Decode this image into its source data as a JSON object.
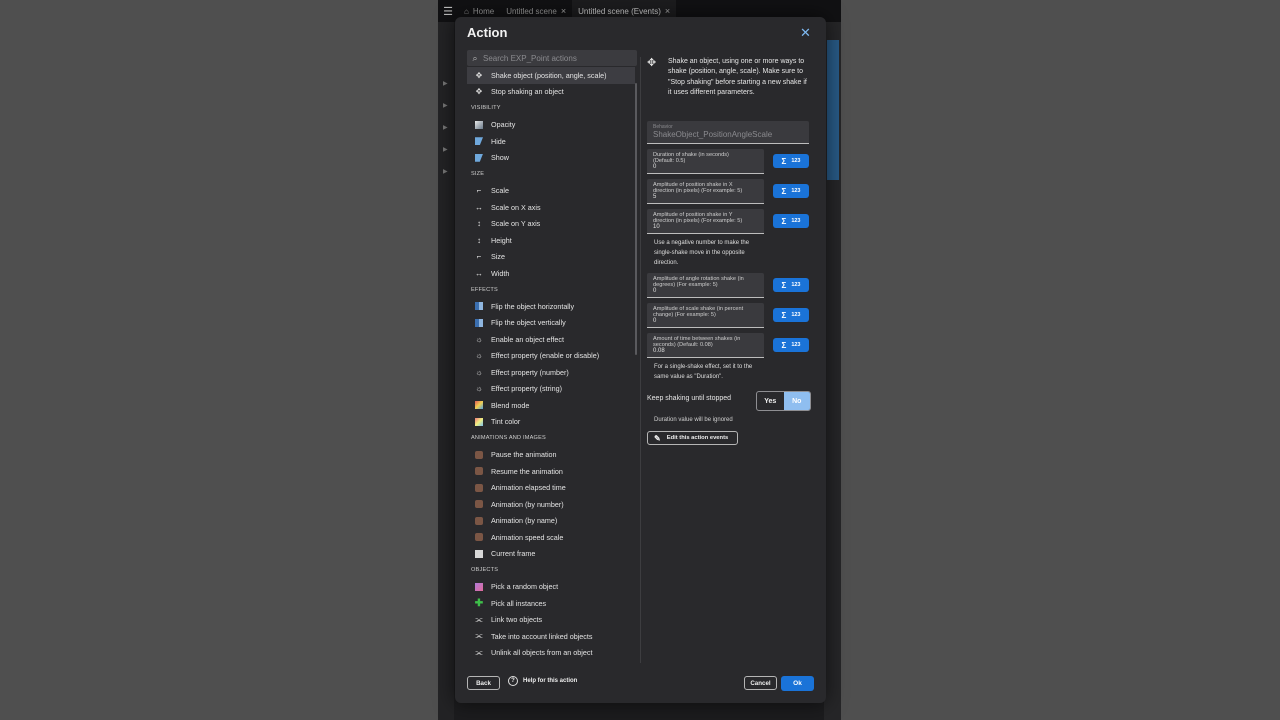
{
  "topbar": {
    "tabs": [
      {
        "label": "Home"
      },
      {
        "label": "Untitled scene"
      },
      {
        "label": "Untitled scene (Events)"
      }
    ]
  },
  "dialog": {
    "title": "Action",
    "search_placeholder": "Search EXP_Point actions",
    "list": {
      "top_items": [
        {
          "label": "Shake object (position, angle, scale)",
          "icon": "move-icon",
          "selected": true
        },
        {
          "label": "Stop shaking an object",
          "icon": "move-icon"
        }
      ],
      "sections": [
        {
          "title": "VISIBILITY",
          "items": [
            {
              "label": "Opacity",
              "icon": "opacity-icon"
            },
            {
              "label": "Hide",
              "icon": "hide-icon"
            },
            {
              "label": "Show",
              "icon": "show-icon"
            }
          ]
        },
        {
          "title": "SIZE",
          "items": [
            {
              "label": "Scale",
              "icon": "scale-icon"
            },
            {
              "label": "Scale on X axis",
              "icon": "resize-horizontal-icon"
            },
            {
              "label": "Scale on Y axis",
              "icon": "resize-vertical-icon"
            },
            {
              "label": "Height",
              "icon": "resize-vertical-icon"
            },
            {
              "label": "Size",
              "icon": "scale-icon"
            },
            {
              "label": "Width",
              "icon": "resize-horizontal-icon"
            }
          ]
        },
        {
          "title": "EFFECTS",
          "items": [
            {
              "label": "Flip the object horizontally",
              "icon": "flip-icon"
            },
            {
              "label": "Flip the object vertically",
              "icon": "flip-icon"
            },
            {
              "label": "Enable an object effect",
              "icon": "effect-icon"
            },
            {
              "label": "Effect property (enable or disable)",
              "icon": "effect-icon"
            },
            {
              "label": "Effect property (number)",
              "icon": "effect-icon"
            },
            {
              "label": "Effect property (string)",
              "icon": "effect-icon"
            },
            {
              "label": "Blend mode",
              "icon": "blend-icon"
            },
            {
              "label": "Tint color",
              "icon": "tint-icon"
            }
          ]
        },
        {
          "title": "ANIMATIONS AND IMAGES",
          "items": [
            {
              "label": "Pause the animation",
              "icon": "animation-icon"
            },
            {
              "label": "Resume the animation",
              "icon": "animation-icon"
            },
            {
              "label": "Animation elapsed time",
              "icon": "animation-icon"
            },
            {
              "label": "Animation (by number)",
              "icon": "animation-icon"
            },
            {
              "label": "Animation (by name)",
              "icon": "animation-icon"
            },
            {
              "label": "Animation speed scale",
              "icon": "animation-icon"
            },
            {
              "label": "Current frame",
              "icon": "frame-icon"
            }
          ]
        },
        {
          "title": "OBJECTS",
          "items": [
            {
              "label": "Pick a random object",
              "icon": "pick-random-icon"
            },
            {
              "label": "Pick all instances",
              "icon": "pick-all-icon"
            },
            {
              "label": "Link two objects",
              "icon": "link-icon"
            },
            {
              "label": "Take into account linked objects",
              "icon": "link-icon"
            },
            {
              "label": "Unlink all objects from an object",
              "icon": "link-icon"
            }
          ]
        }
      ]
    },
    "description": "Shake an object, using one or more ways to shake (position, angle, scale). Make sure to \"Stop shaking\" before starting a new shake if it uses different parameters.",
    "behavior_field": {
      "label": "Behavior",
      "value": "ShakeObject_PositionAngleScale"
    },
    "params": [
      {
        "label": "Duration of shake (in seconds) (Default: 0.5)",
        "value": "0"
      },
      {
        "label": "Amplitude of position shake in X direction (in pixels) (For example: 5)",
        "value": "5"
      },
      {
        "label": "Amplitude of position shake in Y direction (in pixels) (For example: 5)",
        "value": "10"
      },
      {
        "label": "Amplitude of angle rotation shake (in degrees) (For example: 5)",
        "value": "0"
      },
      {
        "label": "Amplitude of scale shake (in percent change) (For example: 5)",
        "value": "0"
      },
      {
        "label": "Amount of time between shakes (in seconds) (Default: 0.08)",
        "value": "0.08"
      }
    ],
    "expr_button_label": "123",
    "help_negative": "Use a negative number to make the single-shake move in the opposite direction.",
    "help_single": "For a single-shake effect, set it to the same value as \"Duration\".",
    "keep_shaking": {
      "label": "Keep shaking until stopped",
      "yes": "Yes",
      "no": "No",
      "selected": "No"
    },
    "duration_ignored": "Duration value will be ignored",
    "edit_events_label": "Edit this action events",
    "footer": {
      "back": "Back",
      "help": "Help for this action",
      "cancel": "Cancel",
      "ok": "Ok"
    },
    "colors": {
      "accent": "#1a73d8",
      "toggle_selected": "#8fbef0",
      "panel": "#29292c"
    }
  }
}
